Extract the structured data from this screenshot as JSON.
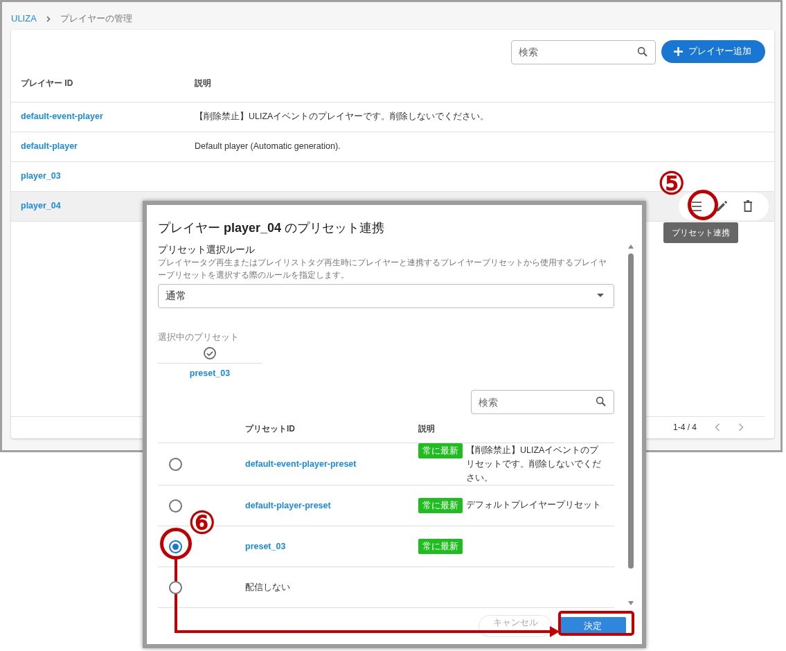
{
  "breadcrumb": [
    {
      "label": "ULIZA",
      "kind": "link"
    },
    {
      "label": "プレイヤーの管理",
      "kind": "current"
    }
  ],
  "search": {
    "placeholder": "検索"
  },
  "add_button": {
    "label": "プレイヤー追加"
  },
  "table": {
    "columns": [
      "プレイヤー ID",
      "説明"
    ],
    "rows": [
      {
        "id": "default-event-player",
        "description": "【削除禁止】ULIZAイベントのプレイヤーです。削除しないでください。",
        "hovered": false
      },
      {
        "id": "default-player",
        "description": "Default player (Automatic generation).",
        "hovered": false
      },
      {
        "id": "player_03",
        "hovered": false
      },
      {
        "id": "player_04",
        "hovered": true
      }
    ]
  },
  "row_actions": {
    "tooltip": "プリセット連携"
  },
  "pagination": {
    "range": "1-4 / 4"
  },
  "dialog": {
    "title": "プレイヤー **player_04** のプリセット連携",
    "rule": {
      "label": "プリセット選択ルール",
      "help": "プレイヤータグ再生またはプレイリストタグ再生時にプレイヤーと連携するプレイヤープリセットから使用するプレイヤープリセットを選択する際のルールを指定します。",
      "value": "通常"
    },
    "selected_preset": {
      "label": "選択中のプリセット",
      "name": "preset_03"
    },
    "search": {
      "placeholder": "検索"
    },
    "columns": [
      "プリセットID",
      "説明"
    ],
    "presets": [
      {
        "id": "default-event-player-preset",
        "kind": "link",
        "badge": "常に最新",
        "description": "【削除禁止】ULIZAイベントのプリセットです。削除しないでください。",
        "selected": false
      },
      {
        "id": "default-player-preset",
        "kind": "link",
        "badge": "常に最新",
        "description": "デフォルトプレイヤープリセット",
        "selected": false
      },
      {
        "id": "preset_03",
        "kind": "link",
        "badge": "常に最新",
        "selected": true
      },
      {
        "id": "配信しない",
        "kind": "plain",
        "selected": false
      }
    ],
    "buttons": [
      {
        "label": "キャンセル",
        "kind": "cancel"
      },
      {
        "label": "決定",
        "kind": "primary"
      }
    ]
  },
  "annotations": [
    {
      "label": "⑤"
    },
    {
      "label": "⑥"
    }
  ]
}
